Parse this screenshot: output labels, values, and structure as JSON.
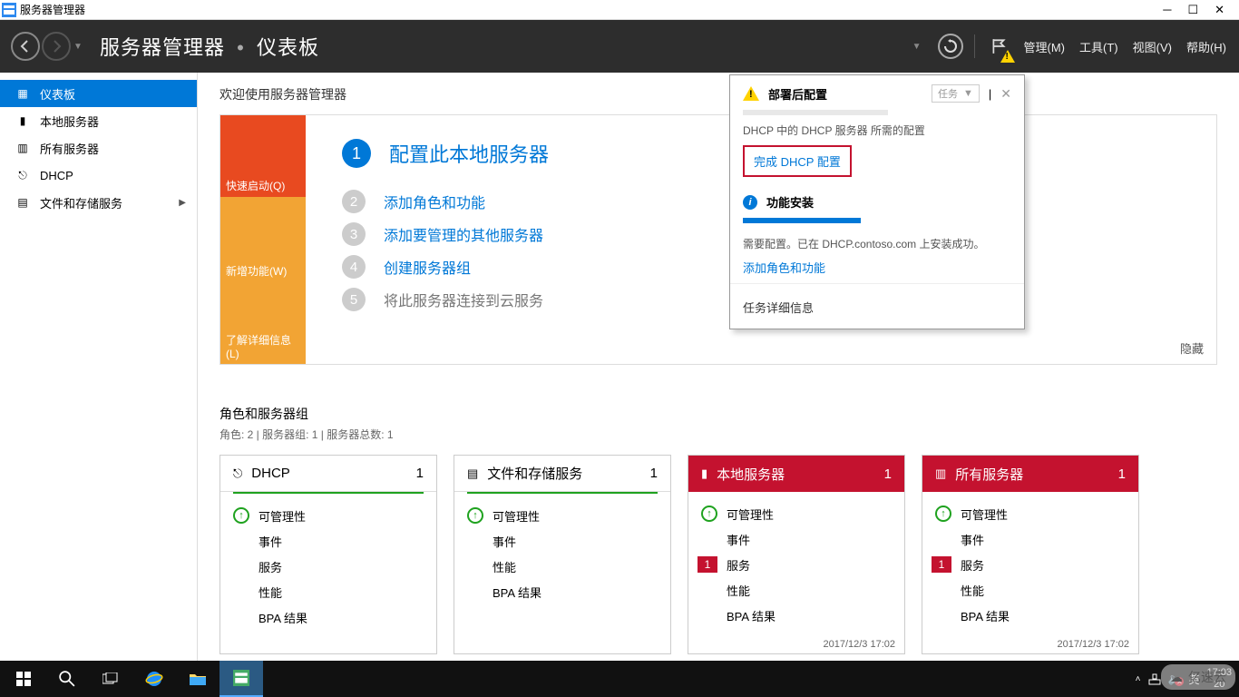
{
  "window": {
    "title": "服务器管理器"
  },
  "header": {
    "breadcrumb_root": "服务器管理器",
    "breadcrumb_page": "仪表板",
    "menu": {
      "manage": "管理(M)",
      "tools": "工具(T)",
      "view": "视图(V)",
      "help": "帮助(H)"
    }
  },
  "sidebar": {
    "items": [
      {
        "icon": "dashboard-icon",
        "label": "仪表板"
      },
      {
        "icon": "server-icon",
        "label": "本地服务器"
      },
      {
        "icon": "all-servers-icon",
        "label": "所有服务器"
      },
      {
        "icon": "dhcp-icon",
        "label": "DHCP"
      },
      {
        "icon": "storage-icon",
        "label": "文件和存储服务",
        "expandable": true
      }
    ]
  },
  "welcome": {
    "title": "欢迎使用服务器管理器",
    "tiles": {
      "quick": "快速启动(Q)",
      "whatsnew": "新增功能(W)",
      "learn": "了解详细信息(L)"
    },
    "steps": [
      {
        "n": "1",
        "text": "配置此本地服务器"
      },
      {
        "n": "2",
        "text": "添加角色和功能"
      },
      {
        "n": "3",
        "text": "添加要管理的其他服务器"
      },
      {
        "n": "4",
        "text": "创建服务器组"
      },
      {
        "n": "5",
        "text": "将此服务器连接到云服务"
      }
    ],
    "hide": "隐藏"
  },
  "groups": {
    "title": "角色和服务器组",
    "subtitle": "角色: 2 | 服务器组: 1 | 服务器总数: 1",
    "labels": {
      "manageability": "可管理性",
      "events": "事件",
      "services": "服务",
      "performance": "性能",
      "bpa": "BPA 结果"
    },
    "cards": [
      {
        "icon": "dhcp-icon",
        "title": "DHCP",
        "count": "1",
        "red": false,
        "timestamp": ""
      },
      {
        "icon": "storage-icon",
        "title": "文件和存储服务",
        "count": "1",
        "red": false,
        "timestamp": "",
        "short": true
      },
      {
        "icon": "server-icon",
        "title": "本地服务器",
        "count": "1",
        "red": true,
        "service_badge": "1",
        "timestamp": "2017/12/3 17:02"
      },
      {
        "icon": "all-servers-icon",
        "title": "所有服务器",
        "count": "1",
        "red": true,
        "service_badge": "1",
        "timestamp": "2017/12/3 17:02"
      }
    ]
  },
  "popup": {
    "tasks_label": "任务",
    "sec1": {
      "title": "部署后配置",
      "desc": "DHCP 中的 DHCP 服务器 所需的配置",
      "link": "完成 DHCP 配置"
    },
    "sec2": {
      "title": "功能安装",
      "desc": "需要配置。已在 DHCP.contoso.com 上安装成功。",
      "link": "添加角色和功能"
    },
    "sec3": {
      "text": "任务详细信息"
    }
  },
  "taskbar": {
    "ime": "英",
    "time": "17:03",
    "date_partial": "20"
  },
  "watermark": "亿速云"
}
